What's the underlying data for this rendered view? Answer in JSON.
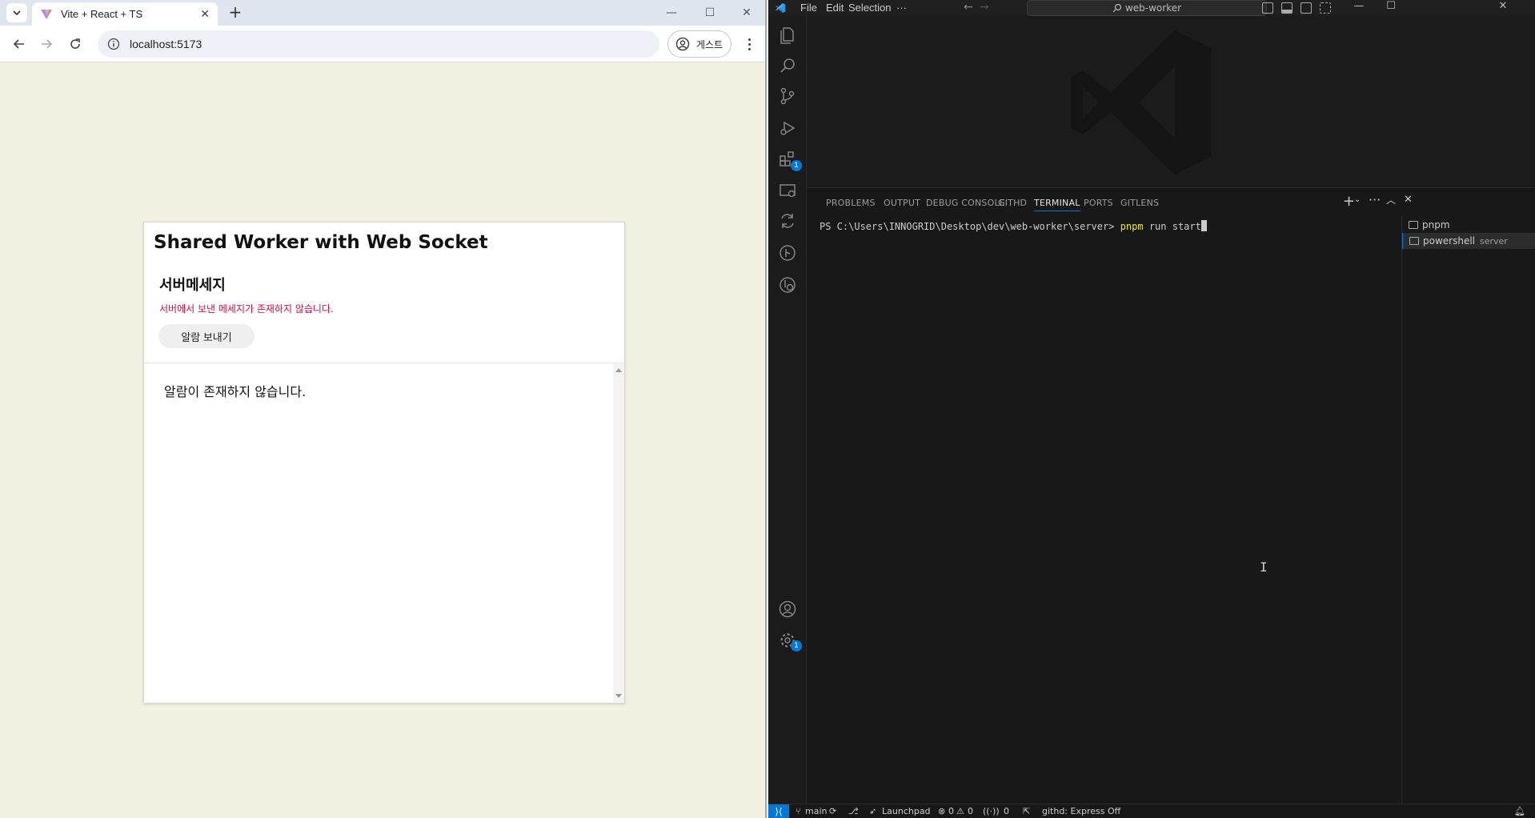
{
  "browser": {
    "tab_title": "Vite + React + TS",
    "url": "localhost:5173",
    "profile_label": "게스트",
    "window_controls": [
      "minimize",
      "maximize",
      "close"
    ]
  },
  "app": {
    "title": "Shared Worker with Web Socket",
    "section_title": "서버메세지",
    "server_message_error": "서버에서 보낸 메세지가 존재하지 않습니다.",
    "send_button": "알람 보내기",
    "alarm_empty": "알람이 존재하지 않습니다."
  },
  "vscode": {
    "menu": [
      "File",
      "Edit",
      "Selection",
      "···"
    ],
    "command_center": "web-worker",
    "activity_badges": {
      "extensions": "1",
      "settings": "1"
    },
    "panel_tabs": [
      "PROBLEMS",
      "OUTPUT",
      "DEBUG CONSOLE",
      "GITHD",
      "TERMINAL",
      "PORTS",
      "GITLENS"
    ],
    "active_panel_tab": "TERMINAL",
    "terminal": {
      "prompt": "PS C:\\Users\\INNOGRID\\Desktop\\dev\\web-worker\\server> ",
      "command": "pnpm",
      "args": " run start"
    },
    "terminal_list": [
      {
        "name": "pnpm",
        "sub": ""
      },
      {
        "name": "powershell",
        "sub": "server"
      }
    ],
    "status": {
      "branch": "main",
      "launchpad": "Launchpad",
      "errors": "0",
      "warnings": "0",
      "ports": "0",
      "githd": "githd: Express Off"
    }
  }
}
